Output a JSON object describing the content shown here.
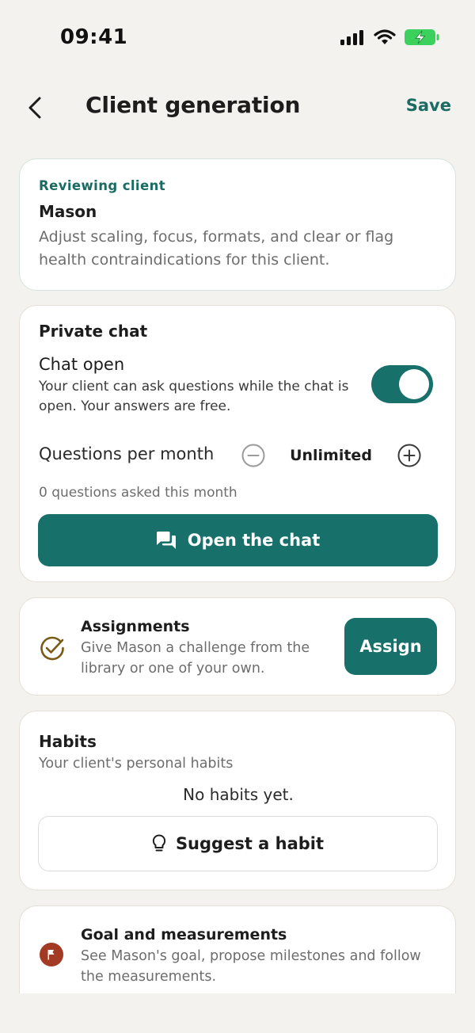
{
  "status_bar": {
    "time": "09:41"
  },
  "header": {
    "title": "Client generation",
    "save_label": "Save"
  },
  "review_card": {
    "eyebrow": "Reviewing client",
    "client_name": "Mason",
    "description": "Adjust scaling, focus, formats, and clear or flag health contraindications for this client."
  },
  "chat_card": {
    "title": "Private chat",
    "chat_open_label": "Chat open",
    "chat_open_description": "Your client can ask questions while the chat is open. Your answers are free.",
    "chat_open_enabled": true,
    "questions_label": "Questions per month",
    "questions_value": "Unlimited",
    "questions_asked": "0 questions asked this month",
    "open_chat_label": "Open the chat"
  },
  "assignments_card": {
    "title": "Assignments",
    "description": "Give Mason a challenge from the library or one of your own.",
    "assign_label": "Assign"
  },
  "habits_card": {
    "title": "Habits",
    "subtitle": "Your client's personal habits",
    "empty_state": "No habits yet.",
    "suggest_label": "Suggest a habit"
  },
  "goal_card": {
    "title": "Goal and measurements",
    "description": "See Mason's goal, propose milestones and follow the measurements."
  },
  "colors": {
    "accent": "#17706a",
    "background": "#f4f2ee",
    "assign_icon": "#7a5a14",
    "goal_icon": "#a23a24",
    "battery": "#3bd15c"
  },
  "icons": {
    "back": "chevron-left-icon",
    "chat": "chat-bubbles-icon",
    "assignments": "check-circle-icon",
    "habit": "lightbulb-icon",
    "goal": "flag-icon"
  }
}
